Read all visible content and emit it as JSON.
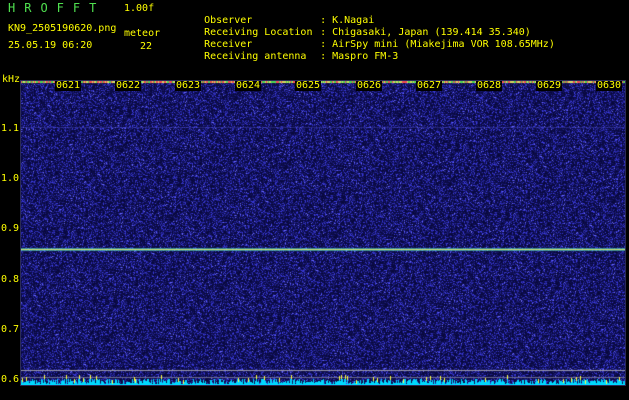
{
  "header": {
    "app_title": "HROFFT",
    "app_version": "1.00f",
    "file_name": "KN9_2505190620.png",
    "meteor_label": "meteor",
    "timestamp": "25.05.19 06:20",
    "meteor_count": "22"
  },
  "info": [
    {
      "key": "Observer",
      "sep": ":",
      "value": "K.Nagai"
    },
    {
      "key": "Receiving Location",
      "sep": ":",
      "value": "Chigasaki, Japan (139.414 35.340)"
    },
    {
      "key": "Receiver",
      "sep": ":",
      "value": "AirSpy mini (Miakejima VOR 108.65MHz)"
    },
    {
      "key": "Receiving antenna",
      "sep": ":",
      "value": "Maspro FM-3"
    }
  ],
  "y_axis": {
    "unit": "kHz",
    "ticks": [
      "1.1",
      "1.0",
      "0.9",
      "0.8",
      "0.7",
      "0.6"
    ]
  },
  "x_axis": {
    "ticks": [
      "0621",
      "0622",
      "0623",
      "0624",
      "0625",
      "0626",
      "0627",
      "0628",
      "0629",
      "0630"
    ]
  },
  "colors": {
    "background": "#000000",
    "text": "#ffff00",
    "title": "#4fe04f",
    "noise_dark": "#0a0a60",
    "noise_bright": "#6a6aff",
    "carrier_line": "#d8e66a",
    "spectrum": "#00e5ff"
  }
}
